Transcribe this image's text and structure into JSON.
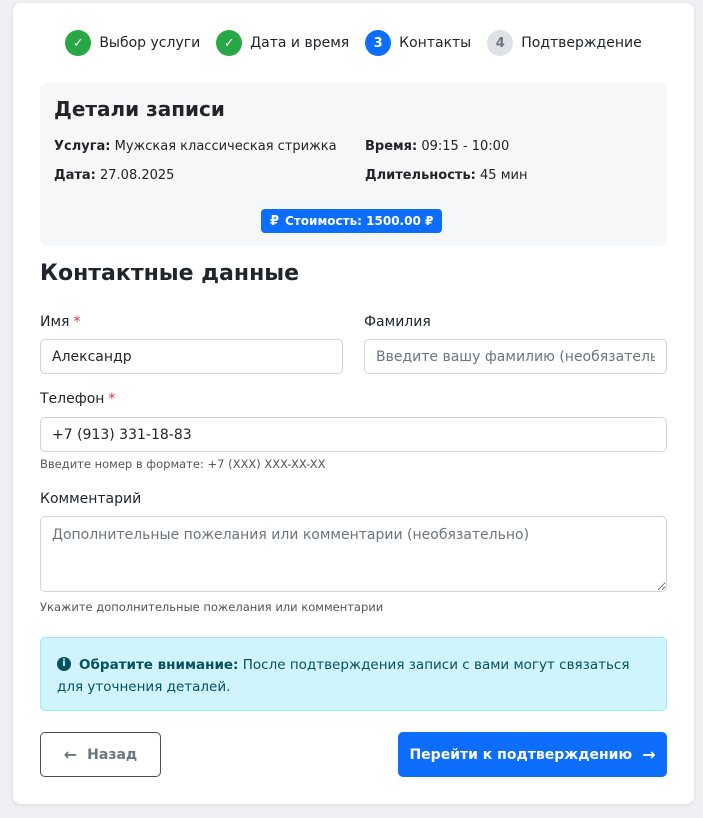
{
  "steps": [
    {
      "label": "Выбор услуги",
      "marker": "✓",
      "state": "done"
    },
    {
      "label": "Дата и время",
      "marker": "✓",
      "state": "done"
    },
    {
      "label": "Контакты",
      "marker": "3",
      "state": "active"
    },
    {
      "label": "Подтверждение",
      "marker": "4",
      "state": "pending"
    }
  ],
  "details": {
    "title": "Детали записи",
    "service_label": "Услуга:",
    "service_value": "Мужская классическая стрижка",
    "time_label": "Время:",
    "time_value": "09:15 - 10:00",
    "date_label": "Дата:",
    "date_value": "27.08.2025",
    "duration_label": "Длительность:",
    "duration_value": "45 мин",
    "price_icon": "₽",
    "price_text": "Стоимость: 1500.00 ₽"
  },
  "contacts": {
    "title": "Контактные данные",
    "first_name_label": "Имя",
    "first_name_value": "Александр",
    "required_mark": "*",
    "last_name_label": "Фамилия",
    "last_name_placeholder": "Введите вашу фамилию (необязательно)",
    "phone_label": "Телефон",
    "phone_value": "+7 (913) 331-18-83",
    "phone_hint": "Введите номер в формате: +7 (XXX) XXX-XX-XX",
    "comment_label": "Комментарий",
    "comment_placeholder": "Дополнительные пожелания или комментарии (необязательно)",
    "comment_hint": "Укажите дополнительные пожелания или комментарии"
  },
  "alert": {
    "icon": "i",
    "strong": "Обратите внимание:",
    "text": " После подтверждения записи с вами могут связаться для уточнения деталей."
  },
  "buttons": {
    "back_arrow": "←",
    "back_label": "Назад",
    "next_label": "Перейти к подтверждению",
    "next_arrow": "→"
  },
  "colors": {
    "primary": "#0d6efd",
    "success": "#28a745",
    "danger": "#dc3545",
    "info_bg": "#cff4fc"
  }
}
